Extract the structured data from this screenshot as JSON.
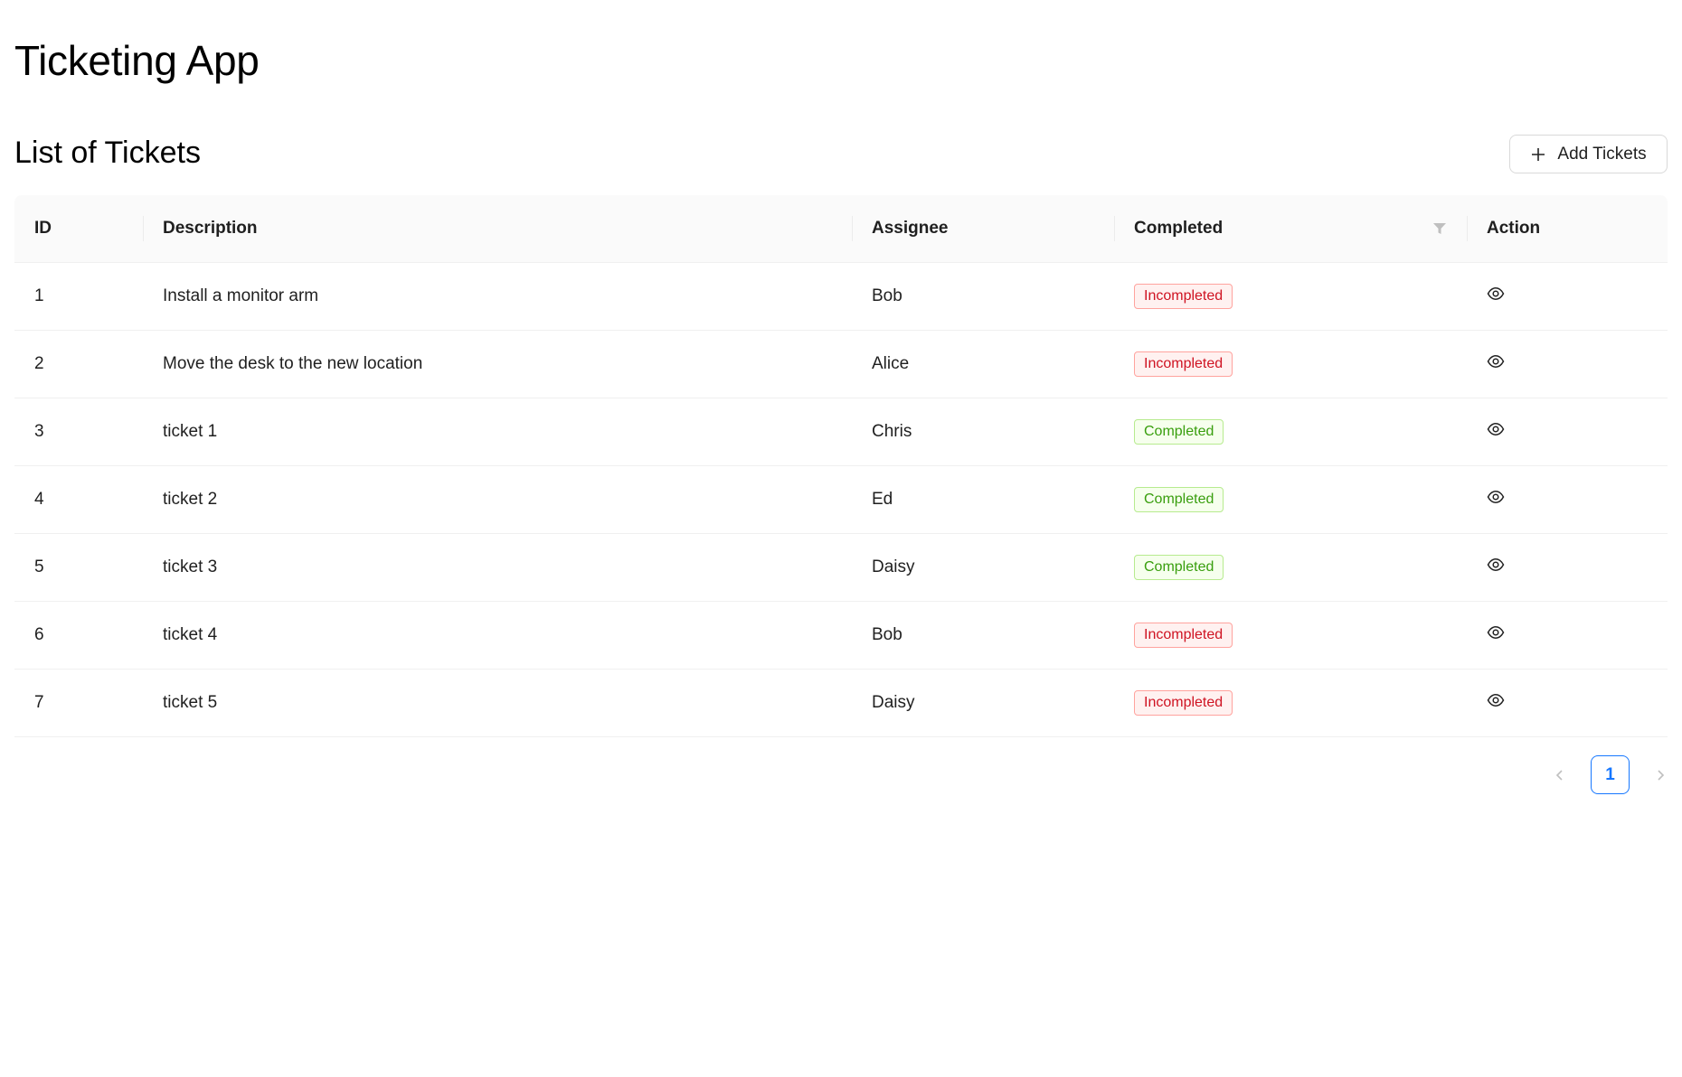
{
  "app": {
    "title": "Ticketing App"
  },
  "section": {
    "title": "List of Tickets",
    "add_button_label": "Add Tickets"
  },
  "table": {
    "columns": [
      "ID",
      "Description",
      "Assignee",
      "Completed",
      "Action"
    ],
    "rows": [
      {
        "id": "1",
        "description": "Install a monitor arm",
        "assignee": "Bob",
        "status": "Incompleted"
      },
      {
        "id": "2",
        "description": "Move the desk to the new location",
        "assignee": "Alice",
        "status": "Incompleted"
      },
      {
        "id": "3",
        "description": "ticket 1",
        "assignee": "Chris",
        "status": "Completed"
      },
      {
        "id": "4",
        "description": "ticket 2",
        "assignee": "Ed",
        "status": "Completed"
      },
      {
        "id": "5",
        "description": "ticket 3",
        "assignee": "Daisy",
        "status": "Completed"
      },
      {
        "id": "6",
        "description": "ticket 4",
        "assignee": "Bob",
        "status": "Incompleted"
      },
      {
        "id": "7",
        "description": "ticket 5",
        "assignee": "Daisy",
        "status": "Incompleted"
      }
    ]
  },
  "pagination": {
    "current_page": "1"
  },
  "colors": {
    "primary": "#1677ff",
    "incomplete_text": "#cf1322",
    "incomplete_bg": "#fff1f0",
    "complete_text": "#389e0d",
    "complete_bg": "#f6ffed"
  }
}
